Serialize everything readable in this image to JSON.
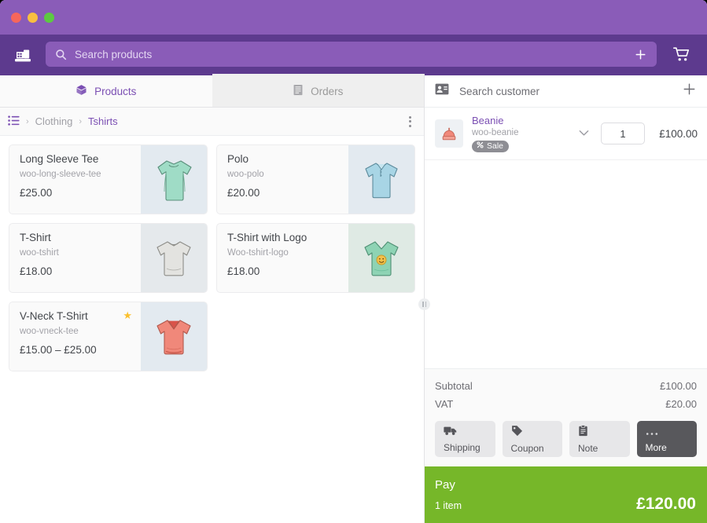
{
  "titlebar": {
    "buttons": [
      "close",
      "minimize",
      "maximize"
    ]
  },
  "header": {
    "logo_icon": "cash-register-icon",
    "search": {
      "icon": "search-icon",
      "placeholder": "Search products",
      "value": ""
    },
    "add_icon": "plus-icon",
    "cart_icon": "shopping-cart-icon"
  },
  "tabs": [
    {
      "label": "Products",
      "icon": "box-icon",
      "active": true
    },
    {
      "label": "Orders",
      "icon": "receipt-icon",
      "active": false
    }
  ],
  "breadcrumb": {
    "list_icon": "list-icon",
    "separator": "›",
    "items": [
      {
        "label": "Clothing",
        "current": false
      },
      {
        "label": "Tshirts",
        "current": true
      }
    ],
    "menu_icon": "kebab-menu-icon"
  },
  "products": [
    {
      "name": "Long Sleeve Tee",
      "sku": "woo-long-sleeve-tee",
      "price": "£25.00",
      "featured": false,
      "thumb": "long-sleeve-tee-image",
      "thumb_bg": "#e3eaf0",
      "garment": "#9fdcc6"
    },
    {
      "name": "Polo",
      "sku": "woo-polo",
      "price": "£20.00",
      "featured": false,
      "thumb": "polo-shirt-image",
      "thumb_bg": "#e3eaf0",
      "garment": "#a8d5e5"
    },
    {
      "name": "T-Shirt",
      "sku": "woo-tshirt",
      "price": "£18.00",
      "featured": false,
      "thumb": "tshirt-image",
      "thumb_bg": "#e5e9ec",
      "garment": "#e3e3e0"
    },
    {
      "name": "T-Shirt with Logo",
      "sku": "Woo-tshirt-logo",
      "price": "£18.00",
      "featured": false,
      "thumb": "tshirt-with-logo-image",
      "thumb_bg": "#dfeae4",
      "garment": "#8ed3b4"
    },
    {
      "name": "V-Neck T-Shirt",
      "sku": "woo-vneck-tee",
      "price": "£15.00 – £25.00",
      "featured": true,
      "star_icon": "star-icon",
      "thumb": "vneck-tshirt-image",
      "thumb_bg": "#e3eaf0",
      "garment": "#f0887a"
    }
  ],
  "customer": {
    "icon": "contact-card-icon",
    "label": "Search customer",
    "add_icon": "plus-icon"
  },
  "cart": {
    "lines": [
      {
        "name": "Beanie",
        "sku": "woo-beanie",
        "badge": {
          "icon": "percent-icon",
          "label": "Sale"
        },
        "chevron_icon": "chevron-down-icon",
        "quantity": "1",
        "total": "£100.00",
        "thumb": "beanie-image"
      }
    ]
  },
  "totals": {
    "rows": [
      {
        "label": "Subtotal",
        "value": "£100.00"
      },
      {
        "label": "VAT",
        "value": "£20.00"
      }
    ]
  },
  "actions": [
    {
      "label": "Shipping",
      "icon": "truck-icon",
      "dark": false
    },
    {
      "label": "Coupon",
      "icon": "tag-icon",
      "dark": false
    },
    {
      "label": "Note",
      "icon": "clipboard-icon",
      "dark": false
    },
    {
      "label": "More",
      "icon": "ellipsis-icon",
      "dark": true
    }
  ],
  "pay": {
    "title": "Pay",
    "items_count": "1 item",
    "amount": "£120.00",
    "color": "#76b729"
  },
  "divider": {
    "handle_icon": "drag-handle-icon"
  }
}
